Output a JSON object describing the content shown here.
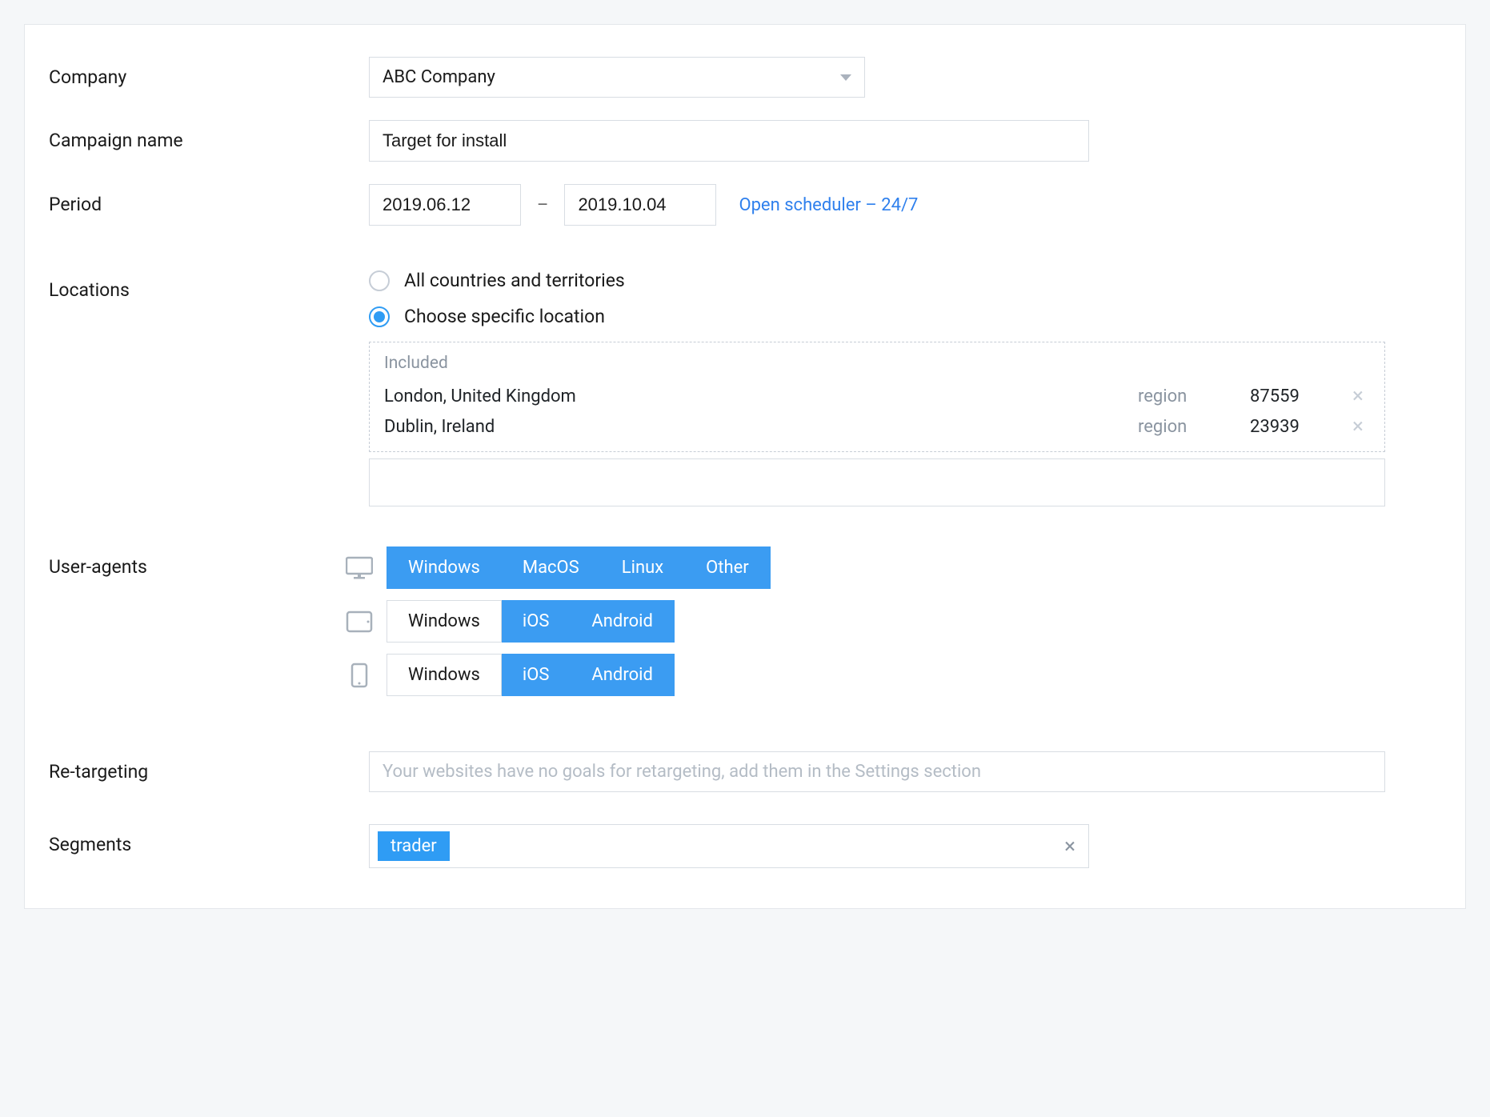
{
  "labels": {
    "company": "Company",
    "campaign_name": "Campaign name",
    "period": "Period",
    "locations": "Locations",
    "user_agents": "User-agents",
    "retargeting": "Re-targeting",
    "segments": "Segments"
  },
  "company": {
    "selected": "ABC Company"
  },
  "campaign_name": "Target for install",
  "period": {
    "start": "2019.06.12",
    "end": "2019.10.04",
    "separator": "–",
    "scheduler_link": "Open scheduler – 24/7"
  },
  "locations": {
    "option_all": "All countries and territories",
    "option_specific": "Choose specific location",
    "selected": "specific",
    "included_header": "Included",
    "items": [
      {
        "name": "London, United Kingdom",
        "type": "region",
        "count": "87559"
      },
      {
        "name": "Dublin, Ireland",
        "type": "region",
        "count": "23939"
      }
    ]
  },
  "user_agents": {
    "rows": [
      {
        "device": "desktop",
        "options": [
          {
            "label": "Windows",
            "active": true
          },
          {
            "label": "MacOS",
            "active": true
          },
          {
            "label": "Linux",
            "active": true
          },
          {
            "label": "Other",
            "active": true
          }
        ]
      },
      {
        "device": "tablet",
        "options": [
          {
            "label": "Windows",
            "active": false
          },
          {
            "label": "iOS",
            "active": true
          },
          {
            "label": "Android",
            "active": true
          }
        ]
      },
      {
        "device": "mobile",
        "options": [
          {
            "label": "Windows",
            "active": false
          },
          {
            "label": "iOS",
            "active": true
          },
          {
            "label": "Android",
            "active": true
          }
        ]
      }
    ]
  },
  "retargeting": {
    "placeholder": "Your websites have no goals for retargeting, add them in the Settings section"
  },
  "segments": {
    "tags": [
      "trader"
    ]
  }
}
